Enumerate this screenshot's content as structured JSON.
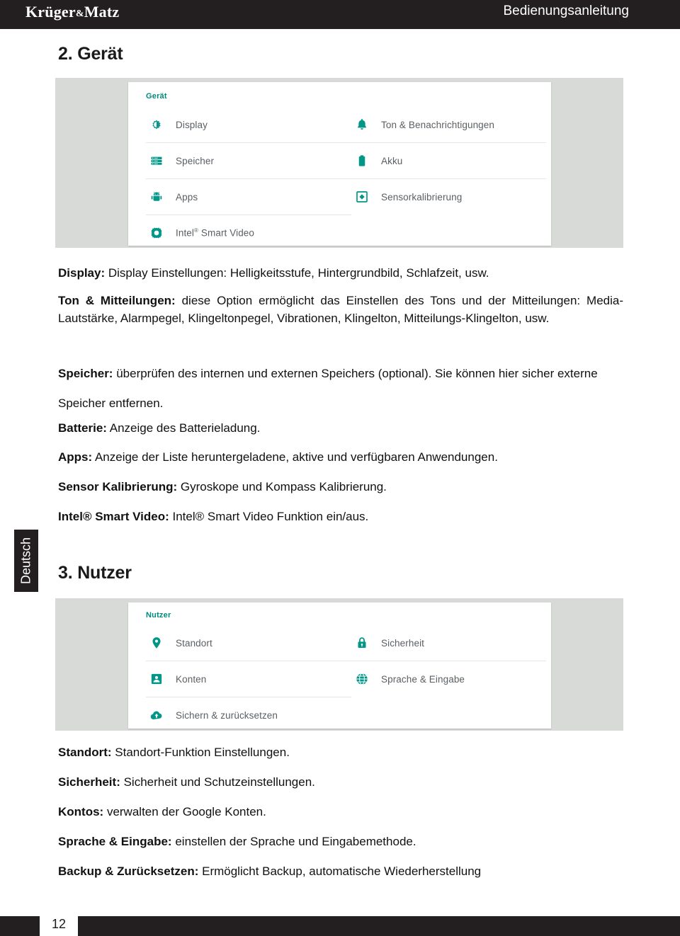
{
  "header": {
    "logo_main": "Krüger",
    "logo_amp": "&",
    "logo_tail": "Matz",
    "title": "Bedienungsanleitung"
  },
  "sections": {
    "geraet_heading": "2. Gerät",
    "nutzer_heading": "3. Nutzer"
  },
  "screenshot_geraet": {
    "group_title": "Gerät",
    "left_items": [
      {
        "icon": "brightness-icon",
        "label": "Display"
      },
      {
        "icon": "storage-icon",
        "label": "Speicher"
      },
      {
        "icon": "android-apps-icon",
        "label": "Apps"
      },
      {
        "icon": "gear-icon",
        "label": "Intel",
        "sup": "®",
        "label_tail": " Smart Video"
      }
    ],
    "right_items": [
      {
        "icon": "bell-icon",
        "label": "Ton & Benachrichtigungen"
      },
      {
        "icon": "battery-icon",
        "label": "Akku"
      },
      {
        "icon": "sensor-calibration-icon",
        "label": "Sensorkalibrierung"
      }
    ]
  },
  "screenshot_nutzer": {
    "group_title": "Nutzer",
    "left_items": [
      {
        "icon": "location-pin-icon",
        "label": "Standort"
      },
      {
        "icon": "account-icon",
        "label": "Konten"
      },
      {
        "icon": "cloud-backup-icon",
        "label": "Sichern & zurücksetzen"
      }
    ],
    "right_items": [
      {
        "icon": "lock-icon",
        "label": "Sicherheit"
      },
      {
        "icon": "globe-icon",
        "label": "Sprache & Eingabe"
      }
    ]
  },
  "body": {
    "display_term": "Display:",
    "display_text": " Display Einstellungen: Helligkeitsstufe, Hintergrundbild, Schlafzeit, usw.",
    "ton_term": "Ton & Mitteilungen:",
    "ton_text": " diese Option ermöglicht das Einstellen des Tons und der Mitteilungen: Media-Lautstärke, Alarmpegel, Klingeltonpegel, Vibrationen, Klingelton, Mitteilungs-Klingelton, usw.",
    "speicher_term": "Speicher:",
    "speicher_text": " überprüfen des internen und externen Speichers (optional). Sie können hier sicher externe Speicher entfernen.",
    "batterie_term": "Batterie:",
    "batterie_text": " Anzeige des Batterieladung.",
    "apps_term": "Apps:",
    "apps_text": " Anzeige der Liste heruntergeladene, aktive und verfügbaren Anwendungen.",
    "sensor_term": "Sensor Kalibrierung:",
    "sensor_text": " Gyroskope und Kompass Kalibrierung.",
    "intel_term": "Intel® Smart Video:",
    "intel_text": " Intel® Smart Video Funktion ein/aus.",
    "standort_term": "Standort:",
    "standort_text": " Standort-Funktion Einstellungen.",
    "sicherheit_term": "Sicherheit:",
    "sicherheit_text": " Sicherheit und Schutzeinstellungen.",
    "kontos_term": "Kontos:",
    "kontos_text": " verwalten der Google Konten.",
    "sprache_term": "Sprache & Eingabe:",
    "sprache_text": " einstellen der Sprache und Eingabemethode.",
    "backup_term": "Backup & Zurücksetzen:",
    "backup_text": " Ermöglicht Backup, automatische Wiederherstellung"
  },
  "language_tab": {
    "label": "Deutsch"
  },
  "footer": {
    "page_number": "12"
  },
  "colors": {
    "header_bar": "#231f20",
    "accent_teal": "#00897b",
    "screenshot_backdrop": "#d8dad8",
    "label_gray": "#5a5f63"
  }
}
